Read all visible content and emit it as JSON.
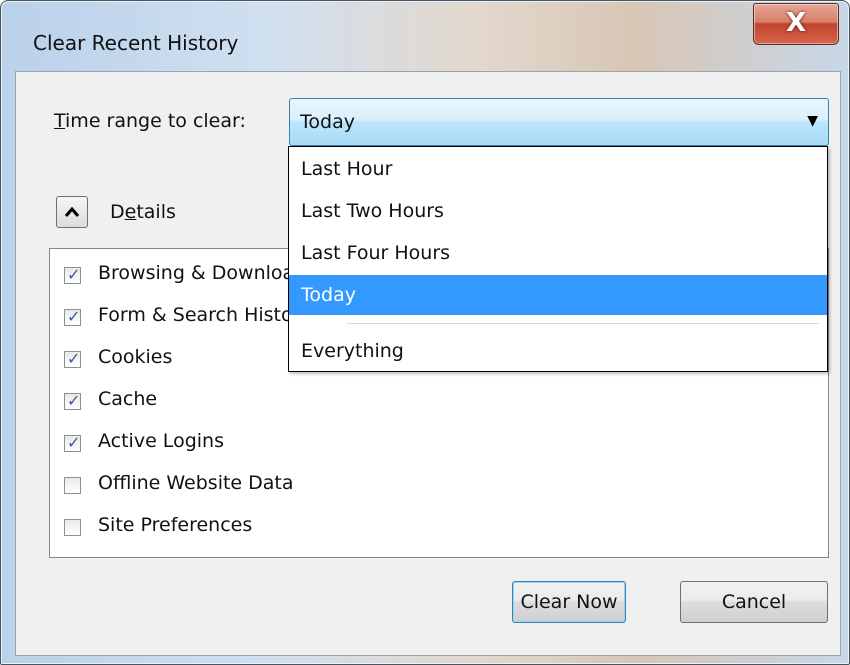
{
  "window": {
    "title": "Clear Recent History",
    "close_label": "X"
  },
  "time_range": {
    "label_prefix": "",
    "label_underline": "T",
    "label_rest": "ime range to clear:",
    "selected": "Today"
  },
  "details": {
    "label_prefix": "D",
    "label_underline": "e",
    "label_rest": "tails"
  },
  "items": [
    {
      "label": "Browsing & Download History",
      "checked": true
    },
    {
      "label": "Form & Search History",
      "checked": true
    },
    {
      "label": "Cookies",
      "checked": true
    },
    {
      "label": "Cache",
      "checked": true
    },
    {
      "label": "Active Logins",
      "checked": true
    },
    {
      "label": "Offline Website Data",
      "checked": false
    },
    {
      "label": "Site Preferences",
      "checked": false
    }
  ],
  "buttons": {
    "clear_now": "Clear Now",
    "cancel": "Cancel"
  },
  "dropdown": {
    "options": [
      "Last Hour",
      "Last Two Hours",
      "Last Four Hours",
      "Today",
      "Everything"
    ],
    "selected_index": 3
  },
  "colors": {
    "selection": "#3399ff",
    "checkmark": "#3d5a98"
  }
}
